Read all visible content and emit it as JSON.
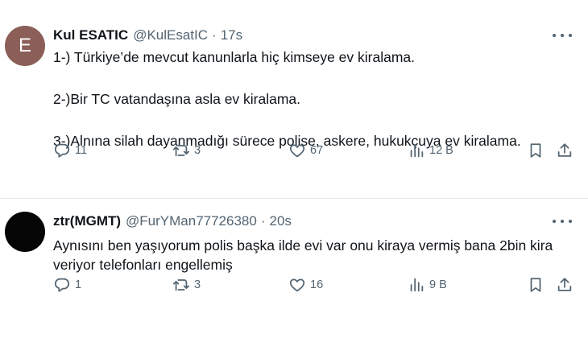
{
  "tweets": [
    {
      "avatar_letter": "E",
      "avatar_color": "#8b5e57",
      "name": "Kul ESATIC",
      "handle": "@KulEsatIC",
      "separator": "·",
      "time": "17s",
      "lines": [
        "1-) Türkiye’de mevcut kanunlarla hiç kimseye ev kiralama.",
        "2-)Bir TC vatandaşına asla ev kiralama.",
        "3-)Alnına silah dayanmadığı sürece polise, askere, hukukçuya ev kiralama."
      ],
      "replies": "11",
      "retweets": "3",
      "likes": "67",
      "views": "12 B"
    },
    {
      "avatar_letter": "",
      "avatar_color": "#050505",
      "name": "ztr(MGMT)",
      "handle": "@FurYMan77726380",
      "separator": "·",
      "time": "20s",
      "lines": [
        "Aynısını ben yaşıyorum polis başka ilde evi var onu kiraya vermiş bana 2bin kira veriyor telefonları engellemiş"
      ],
      "replies": "1",
      "retweets": "3",
      "likes": "16",
      "views": "9 B"
    }
  ],
  "icons": {
    "reply": "reply-icon",
    "retweet": "retweet-icon",
    "like": "heart-icon",
    "views": "views-chart-icon",
    "bookmark": "bookmark-icon",
    "share": "share-icon",
    "more": "more-dots-icon"
  },
  "colors": {
    "text": "#0f1419",
    "secondary": "#536471",
    "divider": "#e6e9ec"
  }
}
